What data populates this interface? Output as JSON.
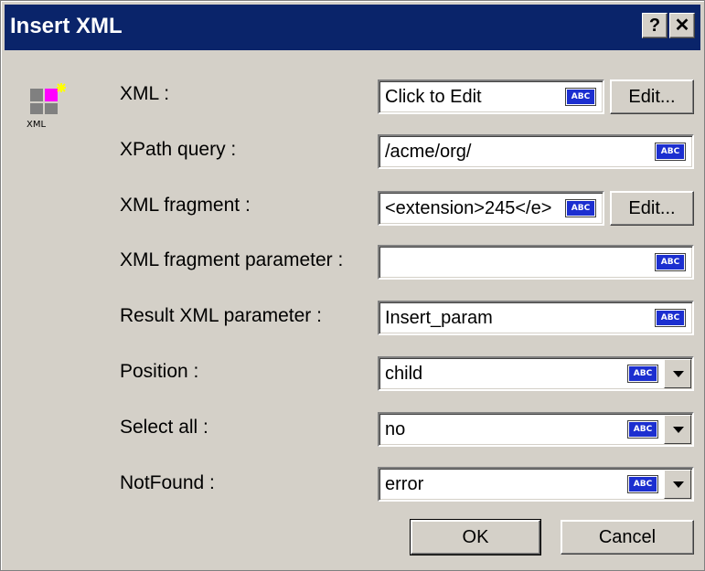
{
  "window": {
    "title": "Insert XML",
    "help_label": "?",
    "close_label": "✕"
  },
  "icon": {
    "name": "xml-icon",
    "caption": "XML"
  },
  "fields": [
    {
      "label": "XML :",
      "value": "Click to Edit",
      "abc": "ABC",
      "edit_label": "Edit..."
    },
    {
      "label": "XPath query :",
      "value": "/acme/org/",
      "abc": "ABC"
    },
    {
      "label": "XML fragment :",
      "value": "<extension>245</e>",
      "abc": "ABC",
      "edit_label": "Edit..."
    },
    {
      "label": "XML fragment parameter :",
      "value": "",
      "abc": "ABC"
    },
    {
      "label": "Result XML parameter :",
      "value": "Insert_param",
      "abc": "ABC"
    },
    {
      "label": "Position :",
      "value": "child",
      "abc": "ABC"
    },
    {
      "label": "Select all :",
      "value": "no",
      "abc": "ABC"
    },
    {
      "label": "NotFound :",
      "value": "error",
      "abc": "ABC"
    }
  ],
  "buttons": {
    "ok": "OK",
    "cancel": "Cancel"
  },
  "colors": {
    "titlebar": "#0a246a",
    "dialog": "#d4d0c8",
    "abc_badge": "#1c2fd0"
  }
}
